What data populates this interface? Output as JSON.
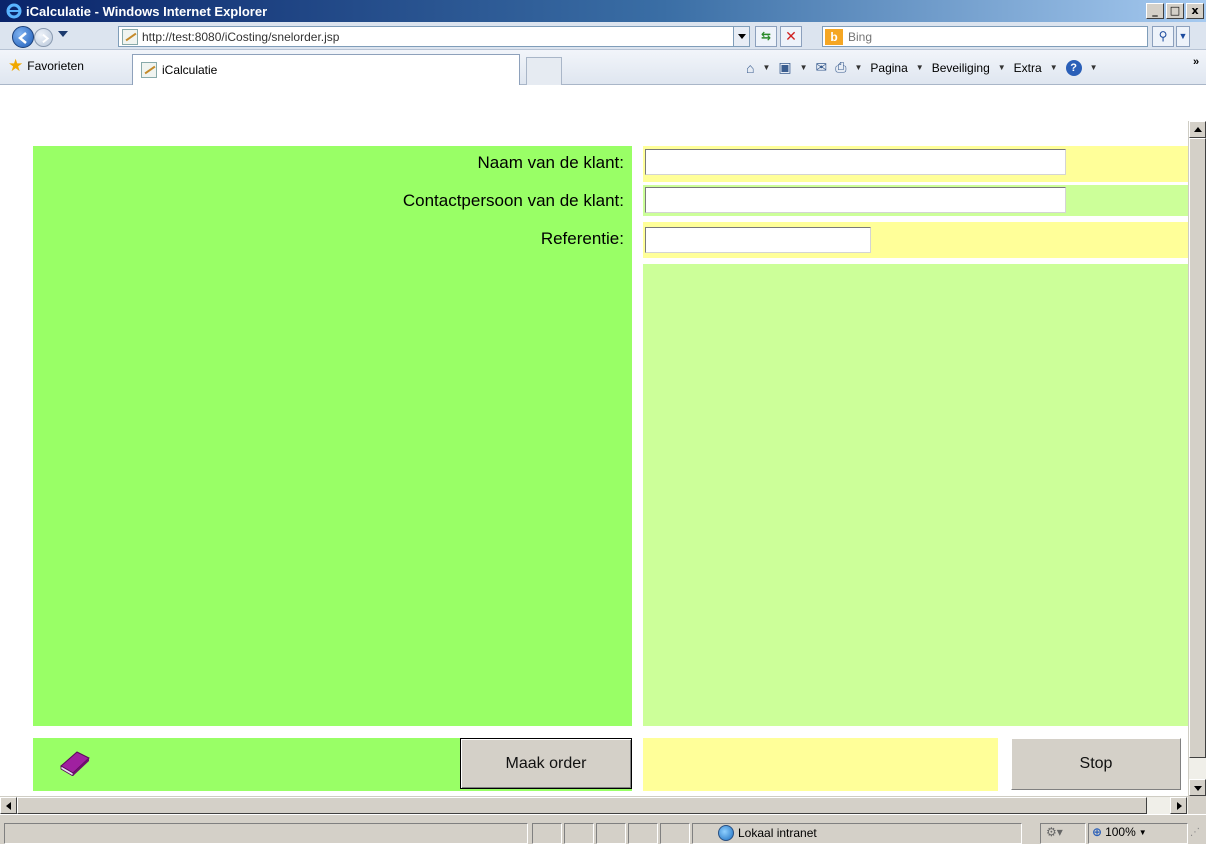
{
  "window": {
    "title": "iCalculatie - Windows Internet Explorer",
    "minimize": "_",
    "maximize": "□",
    "close": "x"
  },
  "browser": {
    "address": "http://test:8080/iCosting/snelorder.jsp",
    "search_placeholder": "Bing",
    "search_logo": "b",
    "favorites_label": "Favorieten",
    "tab_title": "iCalculatie",
    "commands": {
      "page": "Pagina",
      "security": "Beveiliging",
      "extra": "Extra"
    }
  },
  "form": {
    "customer_name_label": "Naam van de klant:",
    "customer_name_value": "",
    "contact_person_label": "Contactpersoon van de klant:",
    "contact_person_value": "",
    "reference_label": "Referentie:",
    "reference_value": "",
    "make_order_button": "Maak order",
    "stop_button": "Stop"
  },
  "statusbar": {
    "zone": "Lokaal intranet",
    "zoom": "100%"
  },
  "colors": {
    "left_panel": "#99ff66",
    "yellow_row": "#ffff99",
    "lightgreen_row": "#ccff99",
    "button_face": "#d4d0c8"
  }
}
